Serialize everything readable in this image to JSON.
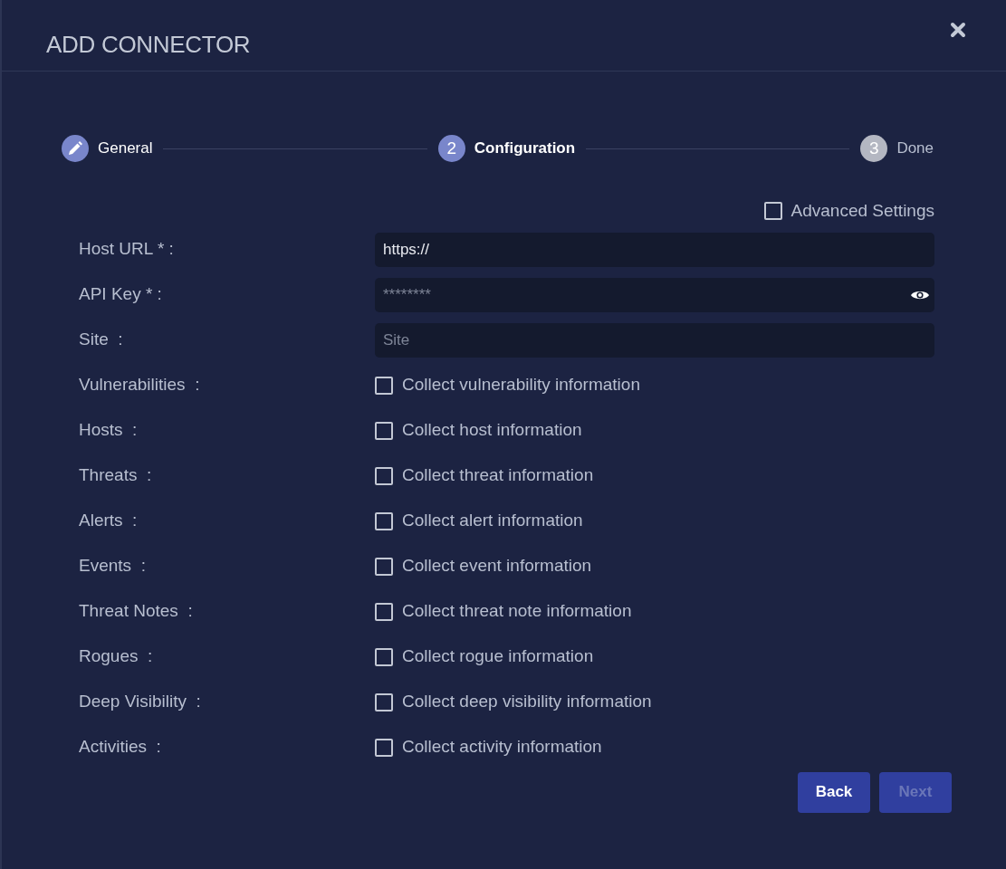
{
  "dialog": {
    "title": "ADD CONNECTOR"
  },
  "steps": [
    {
      "label": "General",
      "completed": true,
      "selected": false
    },
    {
      "label": "Configuration",
      "number": "2",
      "completed": false,
      "selected": true
    },
    {
      "label": "Done",
      "number": "3",
      "completed": false,
      "selected": false
    }
  ],
  "advanced_settings": {
    "label": "Advanced Settings",
    "checked": false
  },
  "fields": [
    {
      "kind": "text",
      "label": "Host URL * :",
      "value": "https://"
    },
    {
      "kind": "password",
      "label": "API Key * :",
      "placeholder": "********"
    },
    {
      "kind": "text",
      "label": "Site  :",
      "placeholder": "Site"
    },
    {
      "kind": "checkbox",
      "label": "Vulnerabilities  :",
      "option": "Collect vulnerability information",
      "checked": false
    },
    {
      "kind": "checkbox",
      "label": "Hosts  :",
      "option": "Collect host information",
      "checked": false
    },
    {
      "kind": "checkbox",
      "label": "Threats  :",
      "option": "Collect threat information",
      "checked": false
    },
    {
      "kind": "checkbox",
      "label": "Alerts  :",
      "option": "Collect alert information",
      "checked": false
    },
    {
      "kind": "checkbox",
      "label": "Events  :",
      "option": "Collect event information",
      "checked": false
    },
    {
      "kind": "checkbox",
      "label": "Threat Notes  :",
      "option": "Collect threat note information",
      "checked": false
    },
    {
      "kind": "checkbox",
      "label": "Rogues  :",
      "option": "Collect rogue information",
      "checked": false
    },
    {
      "kind": "checkbox",
      "label": "Deep Visibility  :",
      "option": "Collect deep visibility information",
      "checked": false
    },
    {
      "kind": "checkbox",
      "label": "Activities  :",
      "option": "Collect activity information",
      "checked": false
    }
  ],
  "buttons": [
    {
      "label": "Back",
      "disabled": false
    },
    {
      "label": "Next",
      "disabled": true
    }
  ]
}
